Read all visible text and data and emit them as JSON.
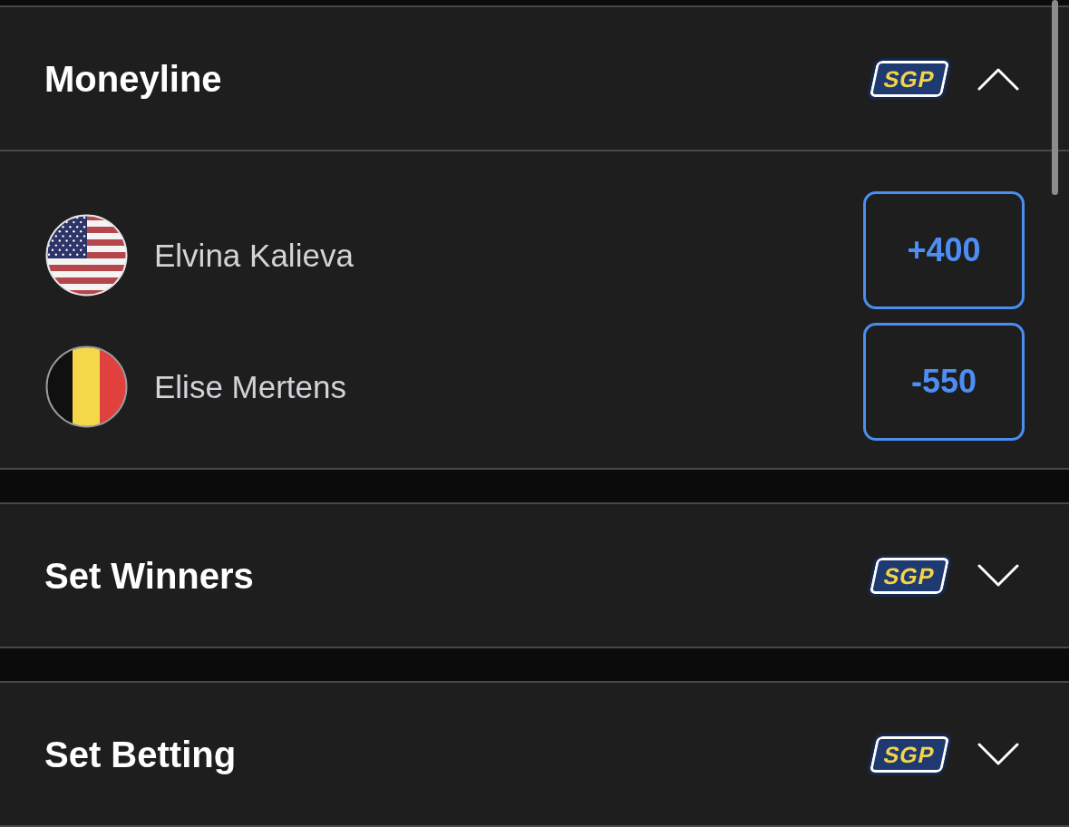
{
  "sections": [
    {
      "title": "Moneyline",
      "badge": "SGP",
      "expanded": true,
      "selections": [
        {
          "kind": "us",
          "name": "Elvina Kalieva",
          "odds": "+400",
          "selected": false
        },
        {
          "kind": "be",
          "name": "Elise Mertens",
          "odds": "-550",
          "selected": false
        }
      ]
    },
    {
      "title": "Set Winners",
      "badge": "SGP",
      "expanded": false
    },
    {
      "title": "Set Betting",
      "badge": "SGP",
      "expanded": false
    }
  ]
}
